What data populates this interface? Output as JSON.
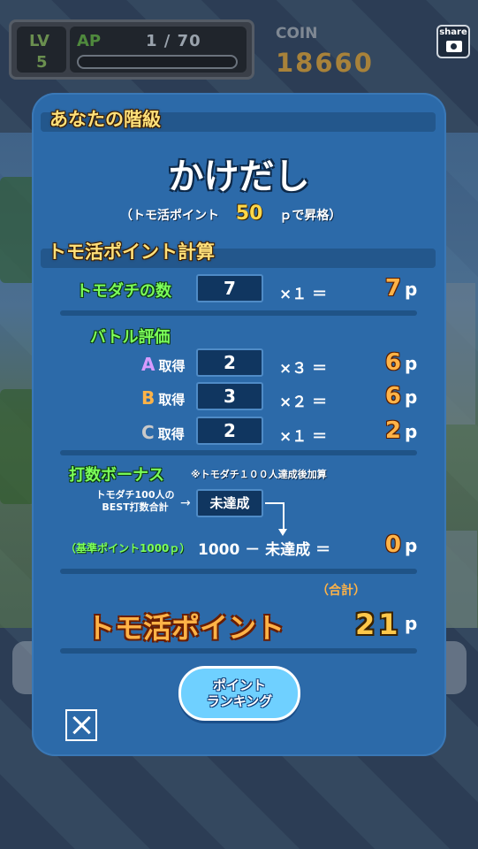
{
  "hud": {
    "lv_label": "LV",
    "lv_value": "5",
    "ap_label": "AP",
    "ap_value": "1 / 70",
    "ap_progress": 0.014,
    "coin_label": "COIN",
    "coin_value": "18660",
    "share_label": "share"
  },
  "dialog": {
    "rank_section_title": "あなたの階級",
    "rank_name": "かけだし",
    "promotion_prefix": "（トモ活ポイント",
    "promotion_points": "50",
    "promotion_suffix": "ｐで昇格）",
    "calc_section_title": "トモ活ポイント計算",
    "friends": {
      "label": "トモダチの数",
      "value": "7",
      "mult": "×１ ＝",
      "points": "7",
      "unit": "p"
    },
    "battle": {
      "label": "バトル評価",
      "rows": [
        {
          "grade": "A",
          "text": "取得",
          "value": "2",
          "mult": "×３ ＝",
          "points": "6",
          "unit": "p"
        },
        {
          "grade": "B",
          "text": "取得",
          "value": "3",
          "mult": "×２ ＝",
          "points": "6",
          "unit": "p"
        },
        {
          "grade": "C",
          "text": "取得",
          "value": "2",
          "mult": "×１ ＝",
          "points": "2",
          "unit": "p"
        }
      ]
    },
    "bonus": {
      "label": "打数ボーナス",
      "note": "※トモダチ１００人達成後加算",
      "desc_line1": "トモダチ100人の",
      "desc_line2": "BEST打数合計",
      "arrow": "→",
      "status": "未達成",
      "base_label": "（基準ポイント1000ｐ）",
      "formula": "1000 － 未達成 ＝",
      "points": "0",
      "unit": "p"
    },
    "total": {
      "sum_label": "（合計）",
      "label": "トモ活ポイント",
      "value": "21",
      "unit": "p"
    },
    "ranking_button": {
      "line1": "ポイント",
      "line2": "ランキング"
    }
  }
}
